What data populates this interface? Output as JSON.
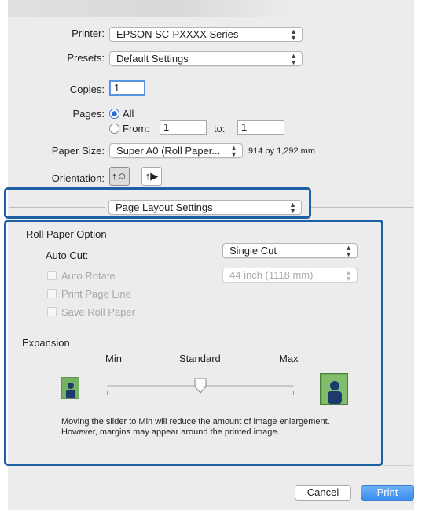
{
  "print": {
    "printer": {
      "label": "Printer:",
      "value": "EPSON SC-PXXXX Series"
    },
    "presets": {
      "label": "Presets:",
      "value": "Default Settings"
    },
    "copies": {
      "label": "Copies:",
      "value": "1"
    },
    "pages": {
      "label": "Pages:",
      "all_label": "All",
      "from_label": "From:",
      "from_value": "1",
      "to_label": "to:",
      "to_value": "1"
    },
    "paper_size": {
      "label": "Paper Size:",
      "value": "Super A0 (Roll Paper...",
      "dimensions": "914 by 1,292 mm"
    },
    "orientation": {
      "label": "Orientation:",
      "portrait_glyph": "↑☺",
      "landscape_glyph": "↑▶"
    },
    "panel_menu": {
      "value": "Page Layout Settings"
    }
  },
  "roll_paper": {
    "section_title": "Roll Paper Option",
    "auto_cut": {
      "label": "Auto Cut:",
      "value": "Single Cut"
    },
    "auto_rotate": {
      "label": "Auto Rotate",
      "enabled": false
    },
    "roll_width": {
      "value": "44 inch (1118 mm)",
      "enabled": false
    },
    "print_page_line": {
      "label": "Print Page Line",
      "enabled": false
    },
    "save_roll_paper": {
      "label": "Save Roll Paper",
      "enabled": false
    }
  },
  "expansion": {
    "section_title": "Expansion",
    "min_label": "Min",
    "standard_label": "Standard",
    "max_label": "Max",
    "slider_level": 0.5,
    "help_line1": "Moving the slider to Min will reduce the amount of image enlargement.",
    "help_line2": "However, margins may appear around the printed image."
  },
  "buttons": {
    "cancel": "Cancel",
    "print": "Print"
  },
  "colors": {
    "highlight": "#1f5fa3",
    "primary_button": "#3b8ef0",
    "thumbnail": "#5c9f4a"
  }
}
